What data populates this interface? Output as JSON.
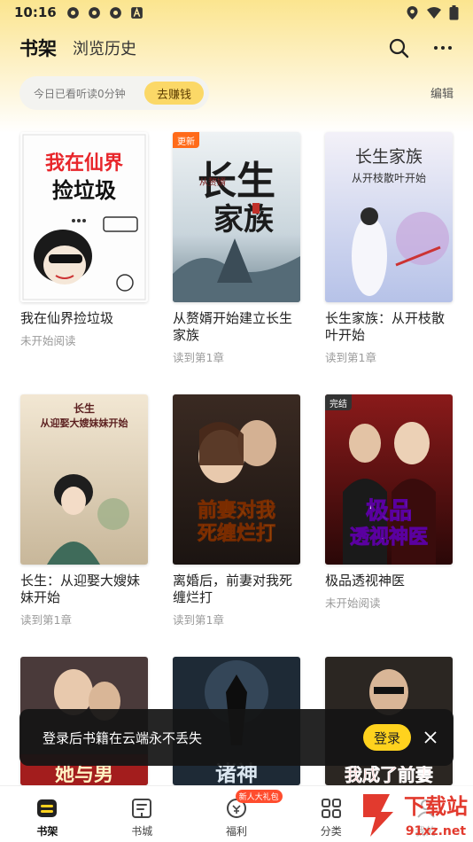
{
  "status": {
    "time": "10:16"
  },
  "header": {
    "tab_shelf": "书架",
    "tab_history": "浏览历史"
  },
  "read_bar": {
    "text": "今日已看听读0分钟",
    "earn_button": "去赚钱"
  },
  "edit_label": "编辑",
  "books": [
    {
      "title": "我在仙界捡垃圾",
      "progress": "未开始阅读",
      "tag": "",
      "cover_text": "我在仙界捡垃圾"
    },
    {
      "title": "从赘婿开始建立长生家族",
      "progress": "读到第1章",
      "tag": "更新",
      "cover_text": "长生家族"
    },
    {
      "title": "长生家族：从开枝散叶开始",
      "progress": "读到第1章",
      "tag": "",
      "cover_text": "长生家族"
    },
    {
      "title": "长生：从迎娶大嫂妹妹开始",
      "progress": "读到第1章",
      "tag": "",
      "cover_text": "长生"
    },
    {
      "title": "离婚后，前妻对我死缠烂打",
      "progress": "读到第1章",
      "tag": "",
      "cover_text": "前妻对我死缠烂打"
    },
    {
      "title": "极品透视神医",
      "progress": "未开始阅读",
      "tag": "完结",
      "cover_text": "极品透视神医"
    }
  ],
  "partial_books": [
    {
      "cover_text": "她与男"
    },
    {
      "cover_text": "诸神"
    },
    {
      "cover_text": "我成了前妻"
    }
  ],
  "toast": {
    "message": "登录后书籍在云端永不丢失",
    "login_button": "登录"
  },
  "nav": [
    {
      "label": "书架",
      "icon": "bookshelf-icon",
      "active": true
    },
    {
      "label": "书城",
      "icon": "book-store-icon",
      "active": false
    },
    {
      "label": "福利",
      "icon": "gift-coin-icon",
      "active": false,
      "badge": "新人大礼包"
    },
    {
      "label": "分类",
      "icon": "category-icon",
      "active": false
    },
    {
      "label": "我的",
      "icon": "profile-icon",
      "active": false
    }
  ],
  "watermark": {
    "text": "下载站",
    "url_text": "91xz.net"
  },
  "colors": {
    "accent": "#fbd867",
    "login": "#ffd21e",
    "tag_orange": "#ff6b1a",
    "badge_red": "#ff4d2e"
  }
}
